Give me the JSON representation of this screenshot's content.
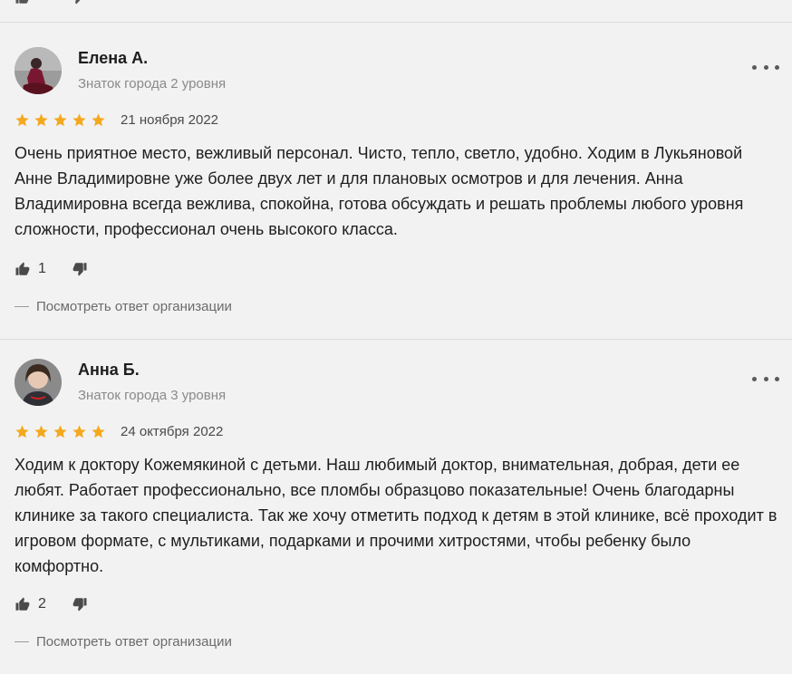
{
  "reviews": [
    {
      "name": "Елена А.",
      "level": "Знаток города 2 уровня",
      "date": "21 ноября 2022",
      "rating": 5,
      "text": "Очень приятное место, вежливый персонал. Чисто, тепло, светло, удобно. Ходим в Лукьяновой Анне Владимировне уже более двух лет и для плановых осмотров и для лечения. Анна Владимировна всегда вежлива, спокойна, готова обсуждать и решать проблемы любого уровня сложности, профессионал очень высокого класса.",
      "likes": "1",
      "reply_link": "Посмотреть ответ организации"
    },
    {
      "name": "Анна Б.",
      "level": "Знаток города 3 уровня",
      "date": "24 октября 2022",
      "rating": 5,
      "text": "Ходим к доктору Кожемякиной с детьми. Наш любимый доктор, внимательная, добрая, дети ее любят. Работает профессионально, все пломбы образцово показательные! Очень благодарны клинике за такого специалиста. Так же хочу отметить подход к детям в этой клинике, всё проходит в игровом формате, с мультиками, подарками и прочими хитростями, чтобы ребенку было комфортно.",
      "likes": "2",
      "reply_link": "Посмотреть ответ организации"
    }
  ],
  "colors": {
    "star": "#f4a81d",
    "muted_text": "#8a8a8a",
    "background": "#f2f2f2"
  },
  "icons": [
    "thumb-up-icon",
    "thumb-down-icon",
    "more-options-icon",
    "star-icon"
  ]
}
